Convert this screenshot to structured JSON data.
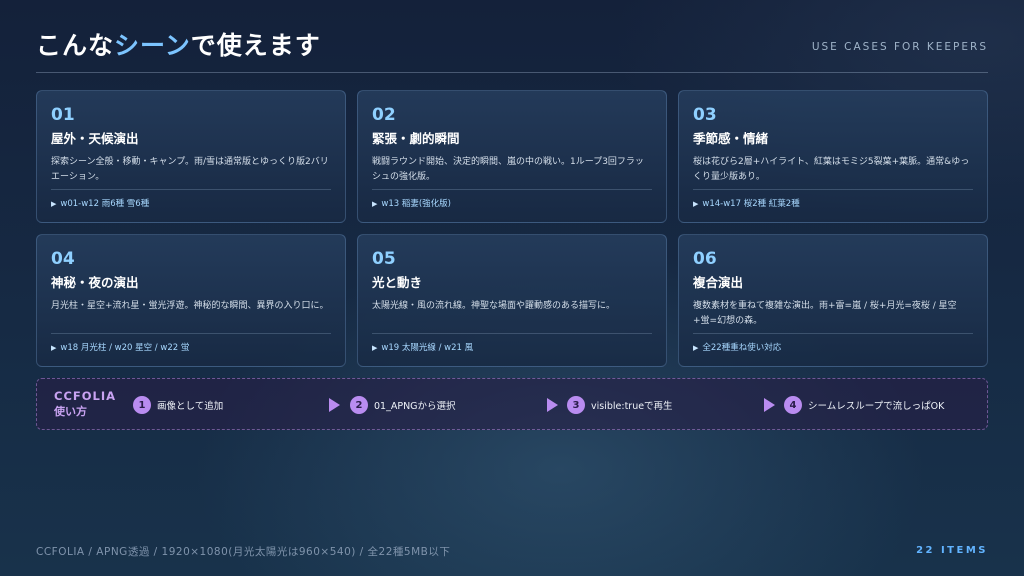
{
  "header": {
    "title_pre": "こんな",
    "title_accent": "シーン",
    "title_post": "で使えます",
    "subtitle": "USE CASES FOR KEEPERS"
  },
  "cards": [
    {
      "num": "01",
      "title": "屋外・天候演出",
      "desc": "探索シーン全般・移動・キャンプ。雨/雪は通常版とゆっくり版2バリエーション。",
      "tag": "w01-w12 雨6種 雪6種"
    },
    {
      "num": "02",
      "title": "緊張・劇的瞬間",
      "desc": "戦闘ラウンド開始、決定的瞬間、嵐の中の戦い。1ループ3回フラッシュの強化版。",
      "tag": "w13 稲妻(強化版)"
    },
    {
      "num": "03",
      "title": "季節感・情緒",
      "desc": "桜は花びら2層+ハイライト、紅葉はモミジ5裂葉+葉脈。通常&ゆっくり量少版あり。",
      "tag": "w14-w17 桜2種 紅葉2種"
    },
    {
      "num": "04",
      "title": "神秘・夜の演出",
      "desc": "月光柱・星空+流れ星・蛍光浮遊。神秘的な瞬間、異界の入り口に。",
      "tag": "w18 月光柱 / w20 星空 / w22 蛍"
    },
    {
      "num": "05",
      "title": "光と動き",
      "desc": "太陽光線・風の流れ線。神聖な場面や躍動感のある描写に。",
      "tag": "w19 太陽光線 / w21 風"
    },
    {
      "num": "06",
      "title": "複合演出",
      "desc": "複数素材を重ねて複雑な演出。雨+雷=嵐 / 桜+月光=夜桜 / 星空+蛍=幻想の森。",
      "tag": "全22種重ね使い対応"
    }
  ],
  "usage": {
    "label_line1": "CCFOLIA",
    "label_line2": "使い方",
    "steps": [
      {
        "num": "1",
        "text": "画像として追加"
      },
      {
        "num": "2",
        "text": "01_APNGから選択"
      },
      {
        "num": "3",
        "text": "visible:trueで再生"
      },
      {
        "num": "4",
        "text": "シームレスループで流しっぱOK"
      }
    ]
  },
  "footer": {
    "left": "CCFOLIA / APNG透過 / 1920×1080(月光太陽光は960×540) / 全22種5MB以下",
    "right": "22 ITEMS"
  },
  "colors": {
    "accent": "#7cc4ff",
    "card_number": "#8fd0ff",
    "step_badge": "#b98cf0",
    "items_count": "#62b4ff"
  },
  "icons": {
    "tag_marker": "triangle-right-icon",
    "step_separator": "play-arrow-icon"
  }
}
